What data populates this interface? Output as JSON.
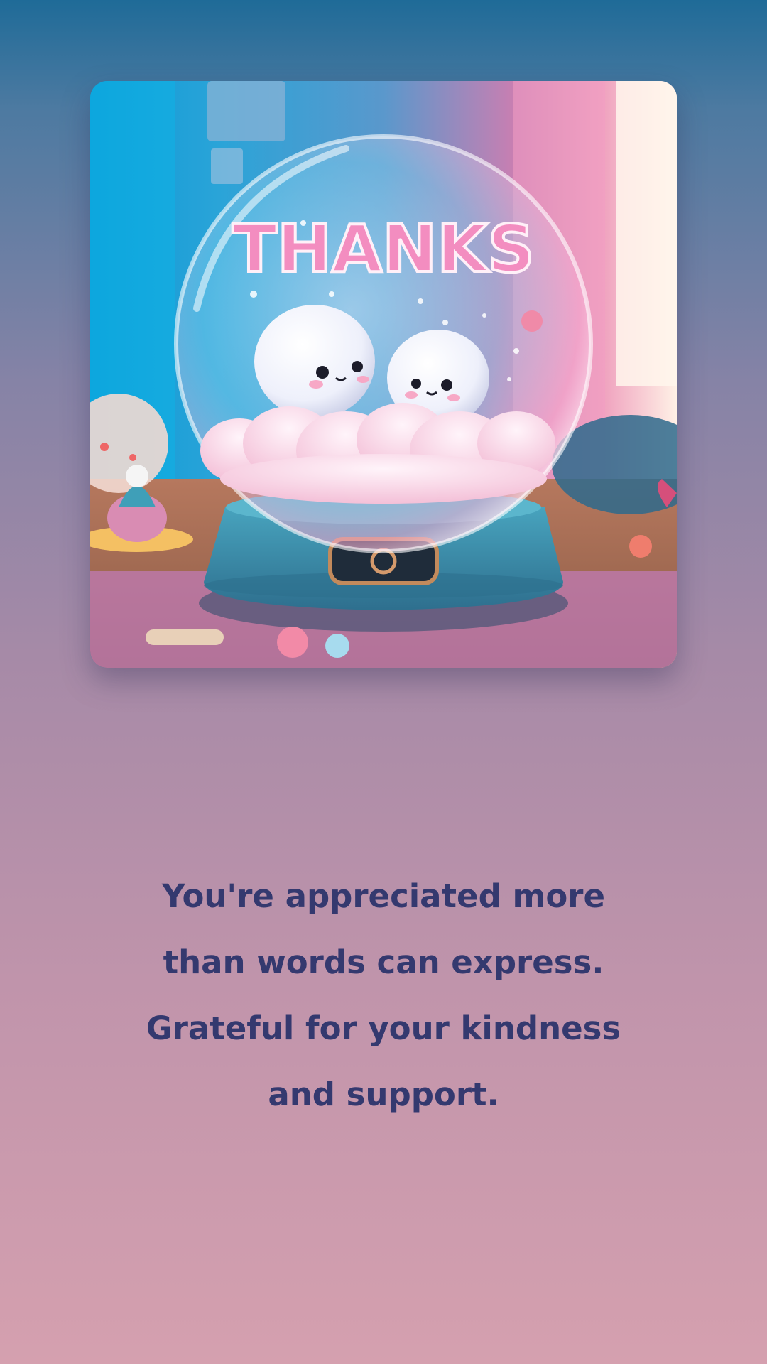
{
  "card": {
    "image": {
      "globe_text": "THANKS",
      "alt": "snow globe with two fluffy characters"
    },
    "message_lines": [
      "You're appreciated more",
      "than words can express.",
      "Grateful for your kindness",
      "and support."
    ]
  },
  "colors": {
    "background_top": "#1f6b98",
    "background_bottom": "#d5a0af",
    "text": "#34396f"
  }
}
